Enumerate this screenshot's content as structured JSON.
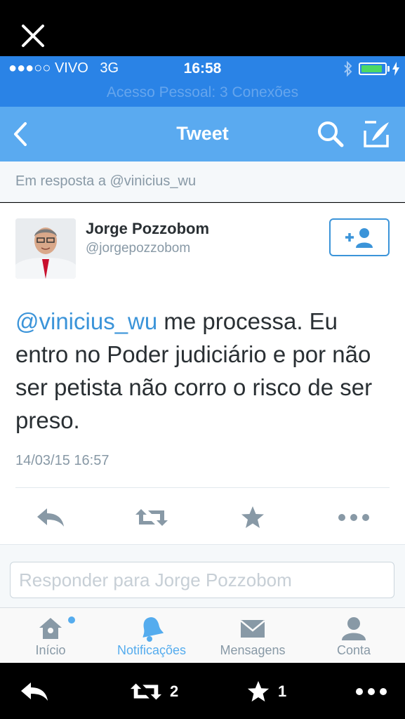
{
  "status": {
    "carrier": "●●●○○ VIVO",
    "network": "3G",
    "time": "16:58",
    "subtitle": "Acesso Pessoal: 3 Conexões",
    "battery_level": 0.92
  },
  "nav": {
    "title": "Tweet"
  },
  "reply_context": "Em resposta a @vinicius_wu",
  "tweet": {
    "name": "Jorge Pozzobom",
    "handle": "@jorgepozzobom",
    "mention": "@vinicius_wu",
    "text": " me processa. Eu entro no Poder judiciário e por não ser petista não corro o risco de ser preso.",
    "timestamp": "14/03/15 16:57"
  },
  "reply_input": {
    "placeholder": "Responder para Jorge Pozzobom"
  },
  "tabs": [
    {
      "label": "Início",
      "icon": "home-icon"
    },
    {
      "label": "Notificações",
      "icon": "bell-icon"
    },
    {
      "label": "Mensagens",
      "icon": "envelope-icon"
    },
    {
      "label": "Conta",
      "icon": "person-icon"
    }
  ],
  "bottom_bar": {
    "retweet_count": "2",
    "favorite_count": "1"
  },
  "colors": {
    "accent": "#55acee",
    "status_bar": "#2a83e6",
    "nav_bar": "#5aaaf0"
  }
}
